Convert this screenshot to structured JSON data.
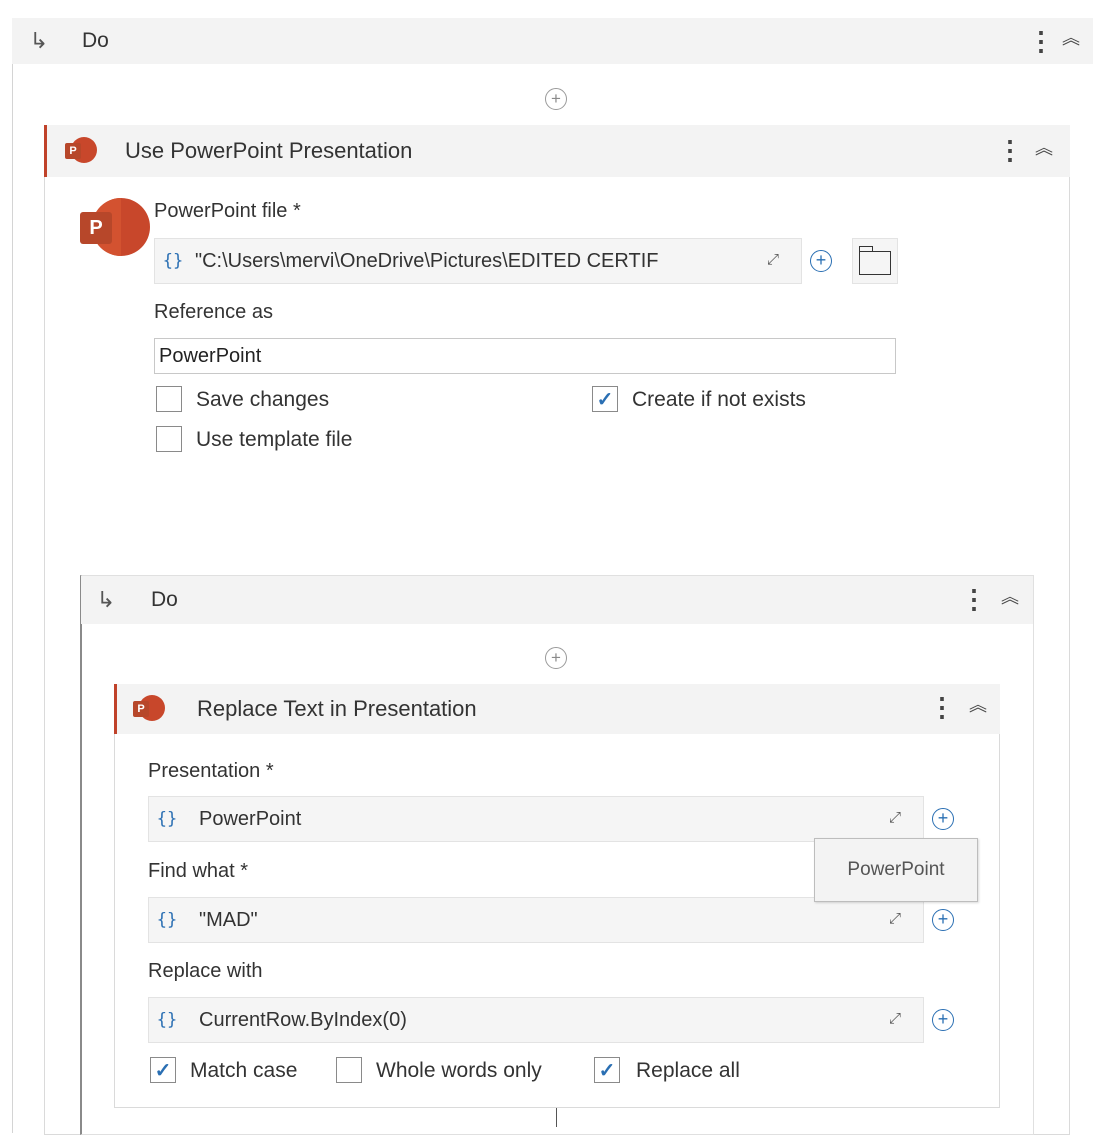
{
  "outer_do": {
    "label": "Do"
  },
  "use_presentation": {
    "title": "Use PowerPoint Presentation",
    "app_icon_letter": "P",
    "file_label": "PowerPoint file *",
    "file_value": "\"C:\\Users\\mervi\\OneDrive\\Pictures\\EDITED CERTIF",
    "reference_label": "Reference as",
    "reference_value": "PowerPoint",
    "save_changes": {
      "label": "Save changes",
      "checked": false
    },
    "create_if_not_exists": {
      "label": "Create if not exists",
      "checked": true
    },
    "use_template_file": {
      "label": "Use template file",
      "checked": false
    }
  },
  "inner_do": {
    "label": "Do"
  },
  "replace_text": {
    "title": "Replace Text in Presentation",
    "presentation_label": "Presentation *",
    "presentation_value": "PowerPoint",
    "find_label": "Find what *",
    "find_value": "\"MAD\"",
    "replace_label": "Replace with",
    "replace_value": "CurrentRow.ByIndex(0)",
    "match_case": {
      "label": "Match case",
      "checked": true
    },
    "whole_words_only": {
      "label": "Whole words only",
      "checked": false
    },
    "replace_all": {
      "label": "Replace all",
      "checked": true
    },
    "tooltip": "PowerPoint"
  },
  "glyphs": {
    "brace": "{}",
    "arrow": "↳",
    "kebab": "⋮",
    "collapse": "≈",
    "plus": "+",
    "expand": "⤢",
    "check": "✓"
  },
  "colors": {
    "accent": "#2a6fb3",
    "ppt": "#c8472b"
  }
}
